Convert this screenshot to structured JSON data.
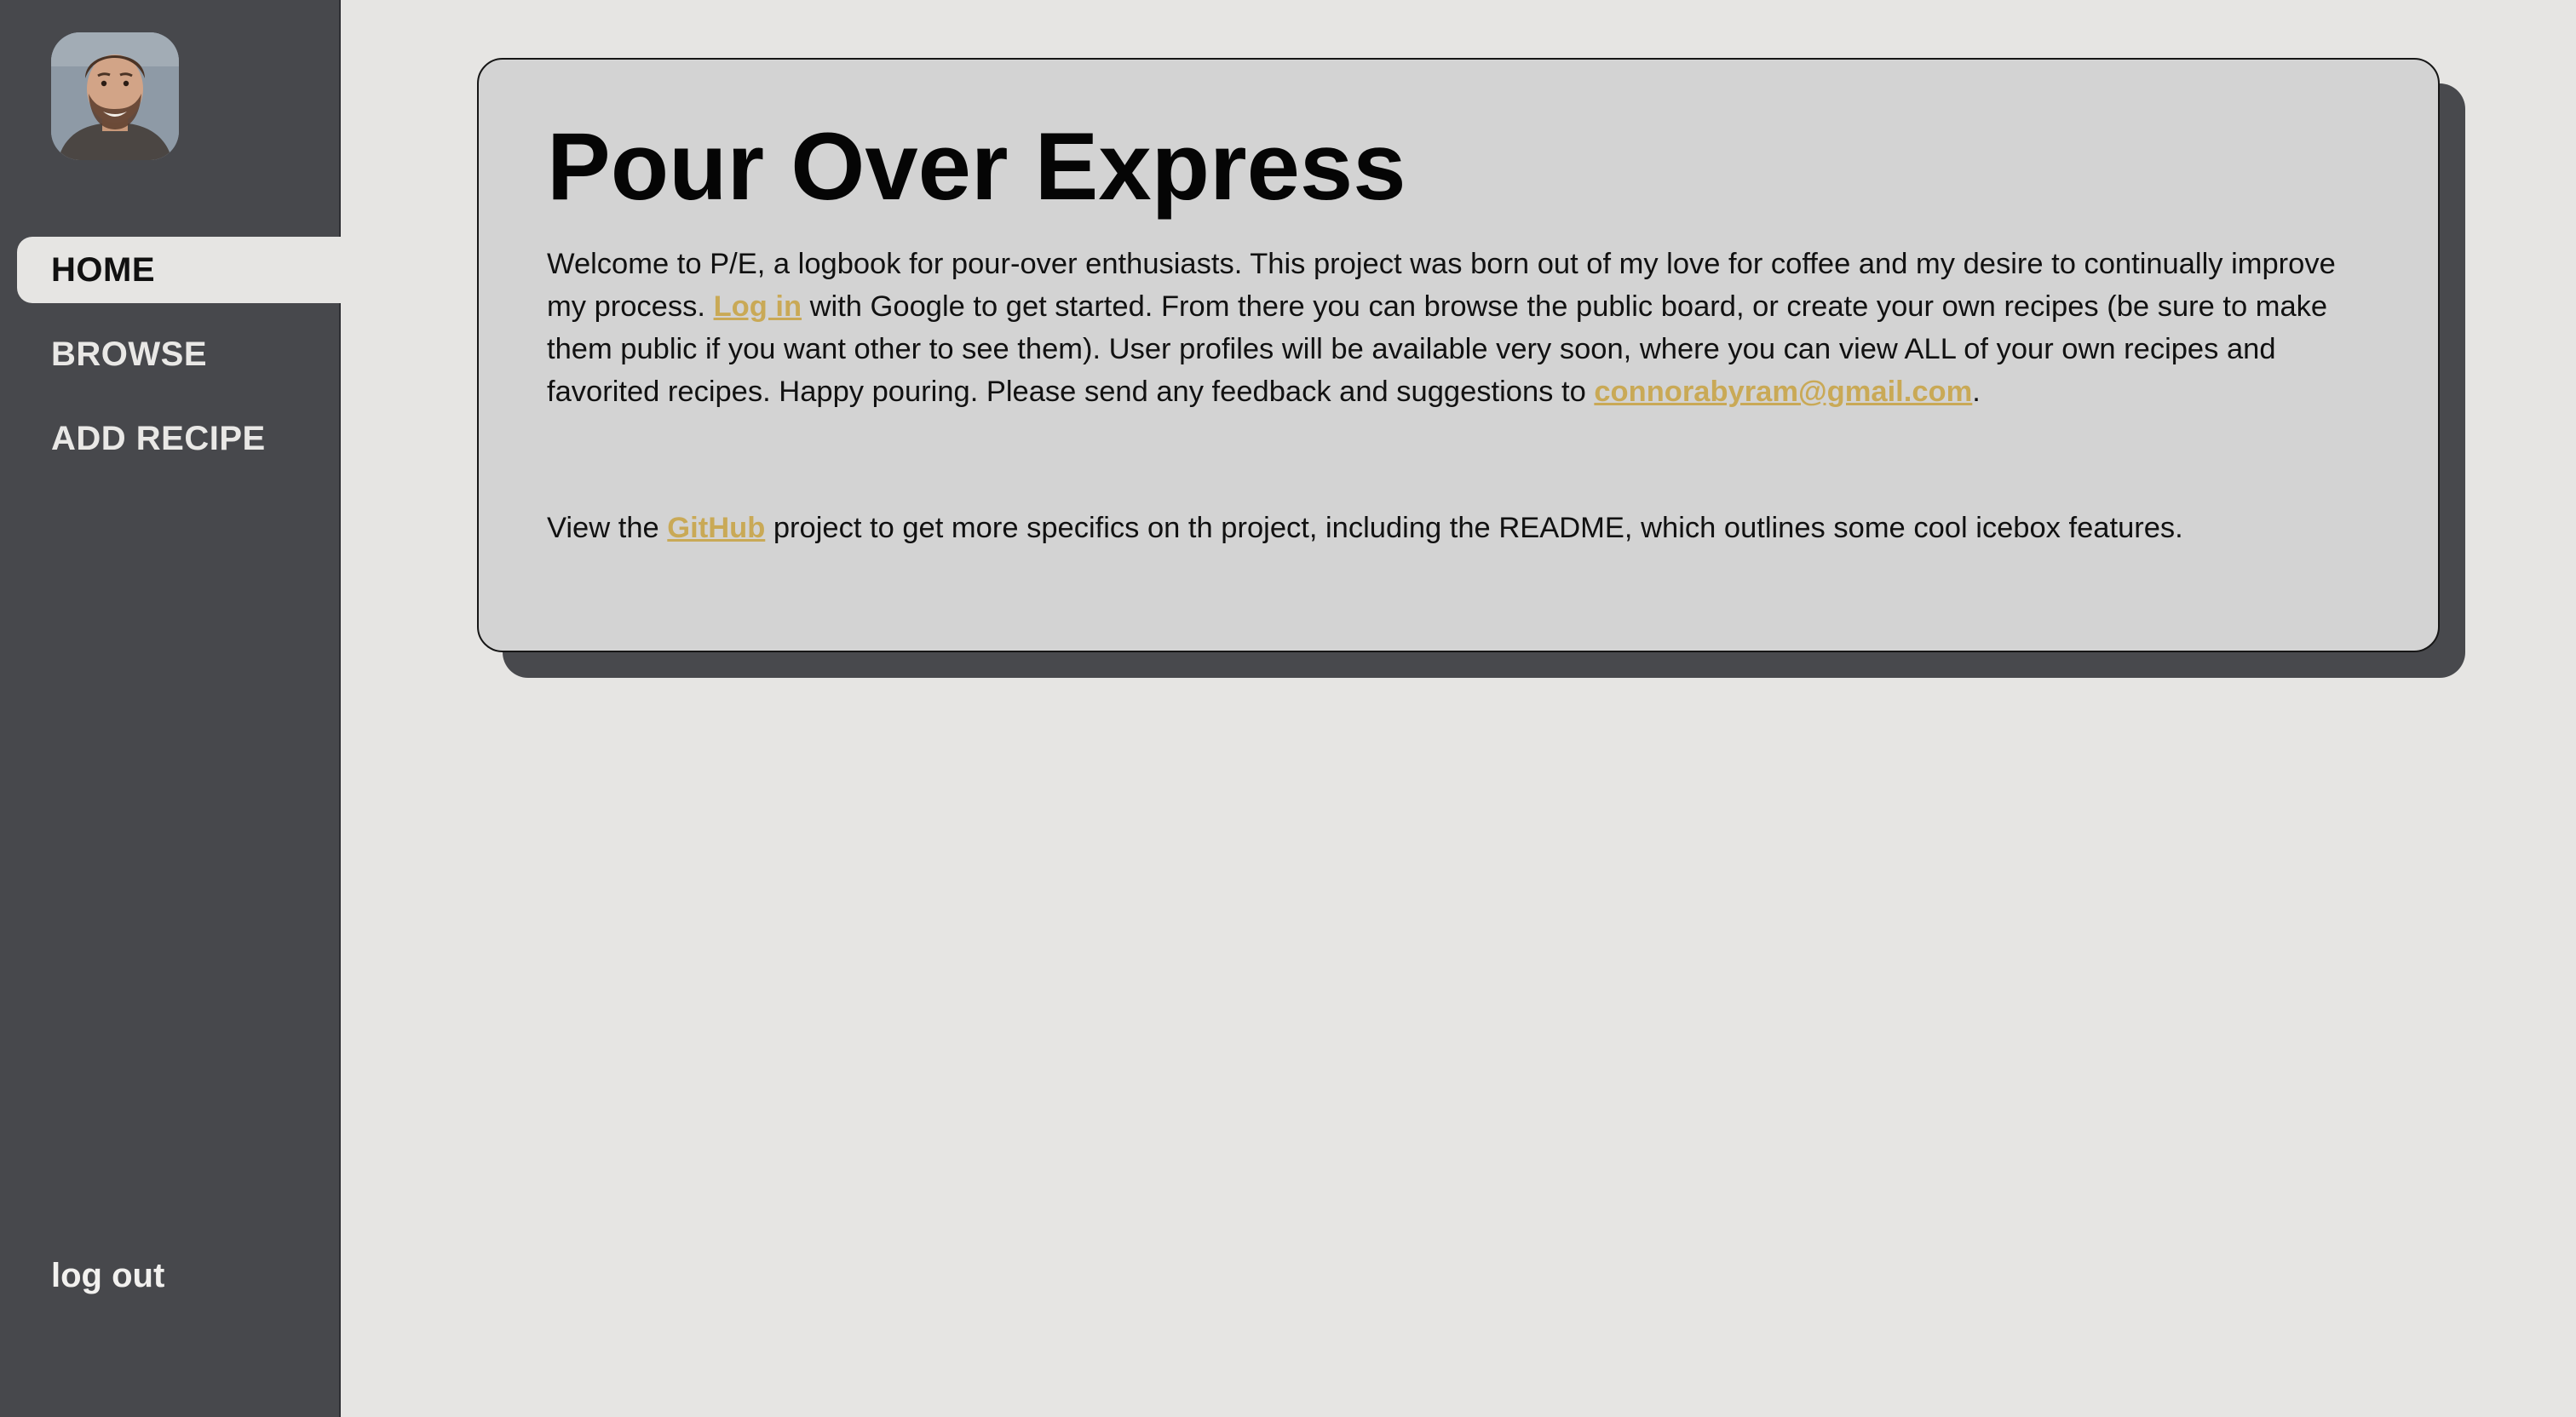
{
  "sidebar": {
    "avatar_label": "User profile photo",
    "nav": {
      "home": "HOME",
      "browse": "BROWSE",
      "add_recipe": "ADD RECIPE"
    },
    "logout": "log out"
  },
  "main": {
    "title": "Pour Over Express",
    "intro": {
      "part1": "Welcome to P/E, a logbook for pour-over enthusiasts. This project was born out of my love for coffee and my desire to continually improve my process.",
      "login_link": "Log in",
      "part2": "with Google to get started. From there you can browse the public board, or create your own recipes (be sure to make them public if you want other to see them). User profiles will be available very soon, where you can view ALL of your own recipes and favorited recipes. Happy pouring. Please send any feedback and suggestions to",
      "email_link": "connorabyram@gmail.com",
      "end": "."
    },
    "github": {
      "before": "View the",
      "link": "GitHub",
      "after": "project to get more specifics on th project, including the README, which outlines some cool icebox features."
    }
  },
  "colors": {
    "sidebar_bg": "#47484c",
    "page_bg": "#e6e5e3",
    "card_bg": "#d3d3d3",
    "card_shadow": "#48494d",
    "link": "#c9a956"
  }
}
